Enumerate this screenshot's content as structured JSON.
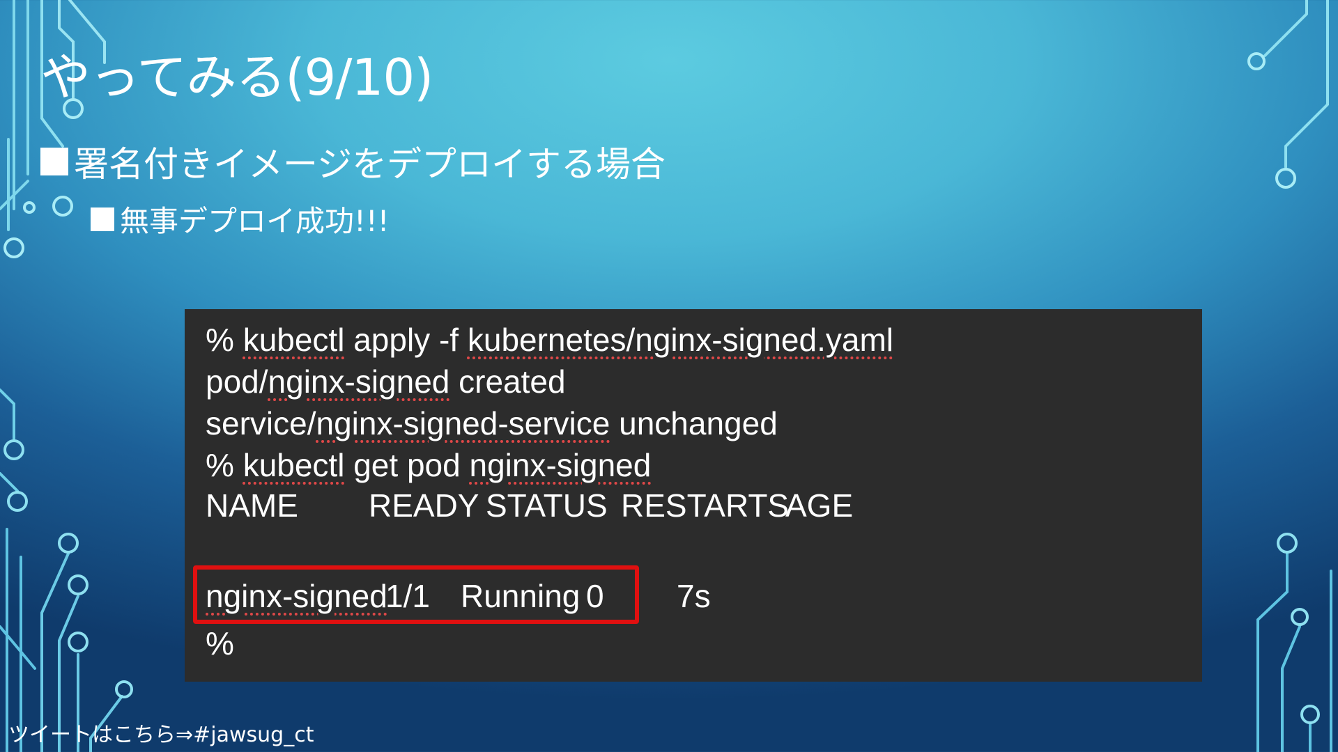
{
  "slide": {
    "title": "やってみる(9/10)",
    "bullet1": "署名付きイメージをデプロイする場合",
    "bullet2": "無事デプロイ成功!!!"
  },
  "terminal": {
    "line1": {
      "prompt": "% ",
      "cmd": "kubectl",
      "rest1": " apply -f ",
      "path": "kubernetes/nginx-signed.yaml"
    },
    "line2": {
      "prefix": "pod/",
      "name": "nginx-signed",
      "rest": " created"
    },
    "line3": {
      "prefix": "service/",
      "name": "nginx-signed-service",
      "rest": " unchanged"
    },
    "line4": {
      "prompt": "% ",
      "cmd": "kubectl",
      "rest1": " get pod ",
      "name": "nginx-signed"
    },
    "table": {
      "headers": [
        "NAME",
        "READY",
        "STATUS",
        "RESTARTS",
        "AGE"
      ],
      "row": [
        "nginx-signed",
        "1/1",
        "Running",
        "0",
        "7s"
      ]
    },
    "line7": "%"
  },
  "footer": "ツイートはこちら⇒#jawsug_ct",
  "colors": {
    "terminal_bg": "#2c2c2c",
    "highlight": "#e01010",
    "spellcheck": "#e04848"
  }
}
